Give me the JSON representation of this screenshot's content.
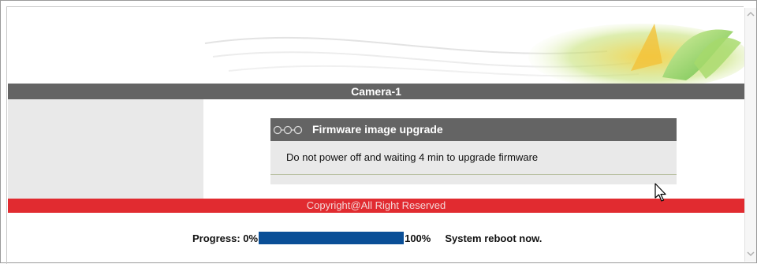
{
  "header": {
    "title": "Camera-1"
  },
  "panel": {
    "icon": "chain-links-icon",
    "title": "Firmware image upgrade",
    "message": "Do not power off and waiting 4 min to upgrade firmware"
  },
  "footer": {
    "copyright": "Copyright@All Right Reserved"
  },
  "progress": {
    "label": "Progress: 0%",
    "end_label": "100%",
    "fraction": 1.0,
    "status": "System reboot now."
  },
  "colors": {
    "title_bar": "#646464",
    "footer_bar": "#e12b30",
    "progress_fill": "#0a4f97",
    "panel_bg": "#e9e9e9"
  },
  "icons": [
    "chain-links-icon",
    "scroll-up-icon",
    "scroll-down-icon",
    "mouse-cursor-icon"
  ]
}
